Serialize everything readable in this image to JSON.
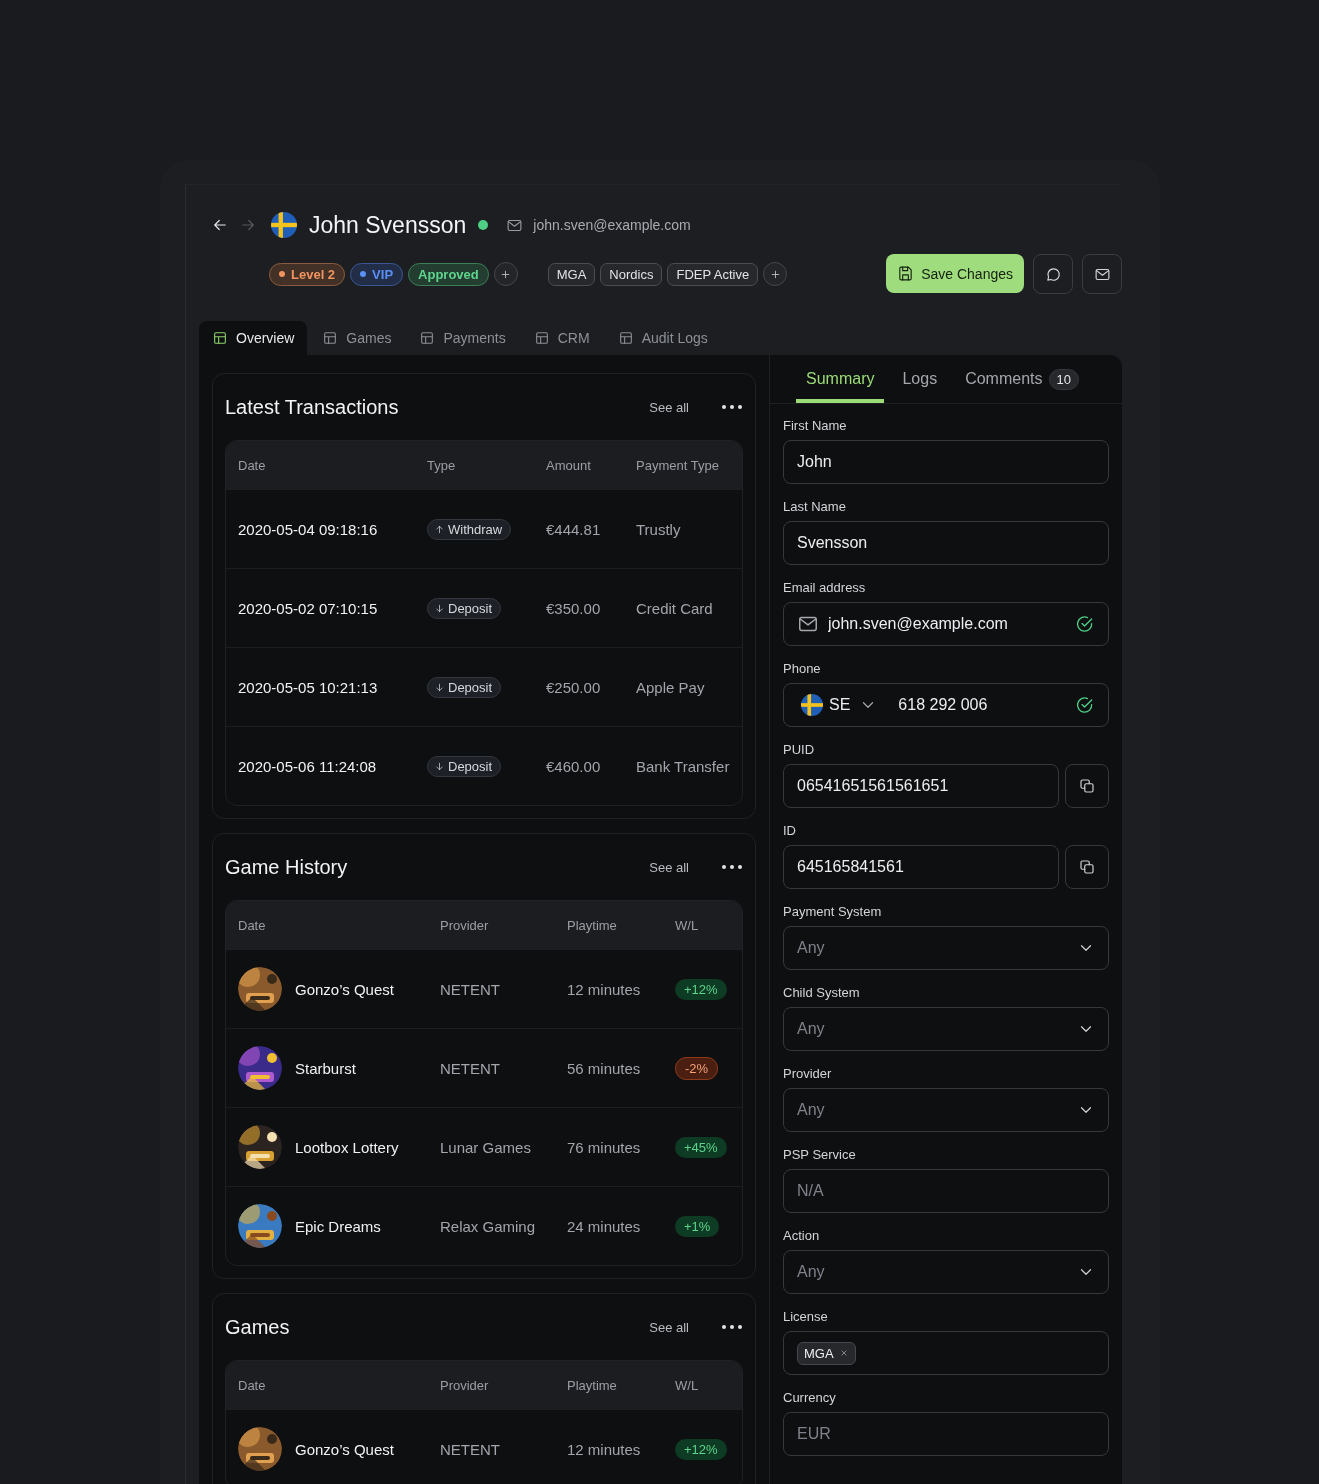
{
  "nav": [
    {
      "kind": "back",
      "disabled": false
    },
    {
      "kind": "forward",
      "disabled": true
    }
  ],
  "player": {
    "name": "John Svensson",
    "online": true,
    "email": "john.sven@example.com"
  },
  "status_tags": [
    {
      "label": "Level 2",
      "color": "#f0955f",
      "dot": true
    },
    {
      "label": "VIP",
      "color": "#5b8ff7",
      "dot": true
    },
    {
      "label": "Approved",
      "color": "#5fd58d",
      "dot": false
    }
  ],
  "region_tags": [
    {
      "label": "MGA"
    },
    {
      "label": "Nordics"
    },
    {
      "label": "FDEP Active"
    }
  ],
  "actions": {
    "save": "Save Changes"
  },
  "tabs": [
    {
      "label": "Overview",
      "selected": true
    },
    {
      "label": "Games",
      "selected": false
    },
    {
      "label": "Payments",
      "selected": false
    },
    {
      "label": "CRM",
      "selected": false
    },
    {
      "label": "Audit Logs",
      "selected": false
    }
  ],
  "transactions": {
    "title": "Latest Transactions",
    "see_all": "See all",
    "columns": [
      "Date",
      "Type",
      "Amount",
      "Payment Type"
    ],
    "rows": [
      {
        "date": "2020-05-04 09:18:16",
        "type": "Withdraw",
        "kind": "withdraw",
        "amount": "€444.81",
        "payment_type": "Trustly"
      },
      {
        "date": "2020-05-02 07:10:15",
        "type": "Deposit",
        "kind": "deposit",
        "amount": "€350.00",
        "payment_type": "Credit Card"
      },
      {
        "date": "2020-05-05 10:21:13",
        "type": "Deposit",
        "kind": "deposit",
        "amount": "€250.00",
        "payment_type": "Apple Pay"
      },
      {
        "date": "2020-05-06 11:24:08",
        "type": "Deposit",
        "kind": "deposit",
        "amount": "€460.00",
        "payment_type": "Bank Transfer"
      }
    ]
  },
  "game_history": {
    "title": "Game History",
    "see_all": "See all",
    "columns": [
      "Date",
      "Provider",
      "Playtime",
      "W/L"
    ],
    "rows": [
      {
        "game": "Gonzo’s Quest",
        "provider": "NETENT",
        "playtime": "12 minutes",
        "wl": "+12%",
        "kind": "win"
      },
      {
        "game": "Starburst",
        "provider": "NETENT",
        "playtime": "56 minutes",
        "wl": "-2%",
        "kind": "loss"
      },
      {
        "game": "Lootbox Lottery",
        "provider": "Lunar Games",
        "playtime": "76 minutes",
        "wl": "+45%",
        "kind": "win"
      },
      {
        "game": "Epic Dreams",
        "provider": "Relax Gaming",
        "playtime": "24 minutes",
        "wl": "+1%",
        "kind": "win"
      }
    ]
  },
  "games": {
    "title": "Games",
    "see_all": "See all",
    "columns": [
      "Date",
      "Provider",
      "Playtime",
      "W/L"
    ],
    "rows": [
      {
        "game": "Gonzo’s Quest",
        "provider": "NETENT",
        "playtime": "12 minutes",
        "wl": "+12%",
        "kind": "win"
      }
    ]
  },
  "side_tabs": [
    {
      "label": "Summary",
      "selected": true
    },
    {
      "label": "Logs",
      "selected": false
    },
    {
      "label": "Comments",
      "selected": false,
      "count": "10"
    }
  ],
  "fields": [
    {
      "kind": "text",
      "label": "First Name",
      "value": "John"
    },
    {
      "kind": "text",
      "label": "Last Name",
      "value": "Svensson"
    },
    {
      "kind": "email",
      "label": "Email address",
      "value": "john.sven@example.com",
      "verified": true
    },
    {
      "kind": "phone",
      "label": "Phone",
      "country": "SE",
      "value": "618 292 006",
      "verified": true
    },
    {
      "kind": "copy",
      "label": "PUID",
      "value": "06541651561561651"
    },
    {
      "kind": "copy",
      "label": "ID",
      "value": "645165841561"
    },
    {
      "kind": "select",
      "label": "Payment System",
      "placeholder": "Any"
    },
    {
      "kind": "select",
      "label": "Child System",
      "placeholder": "Any"
    },
    {
      "kind": "select",
      "label": "Provider",
      "placeholder": "Any"
    },
    {
      "kind": "text",
      "label": "PSP Service",
      "placeholder": "N/A"
    },
    {
      "kind": "select",
      "label": "Action",
      "placeholder": "Any"
    },
    {
      "kind": "tags",
      "label": "License",
      "chips": [
        "MGA"
      ]
    },
    {
      "kind": "text",
      "label": "Currency",
      "placeholder": "EUR"
    }
  ]
}
